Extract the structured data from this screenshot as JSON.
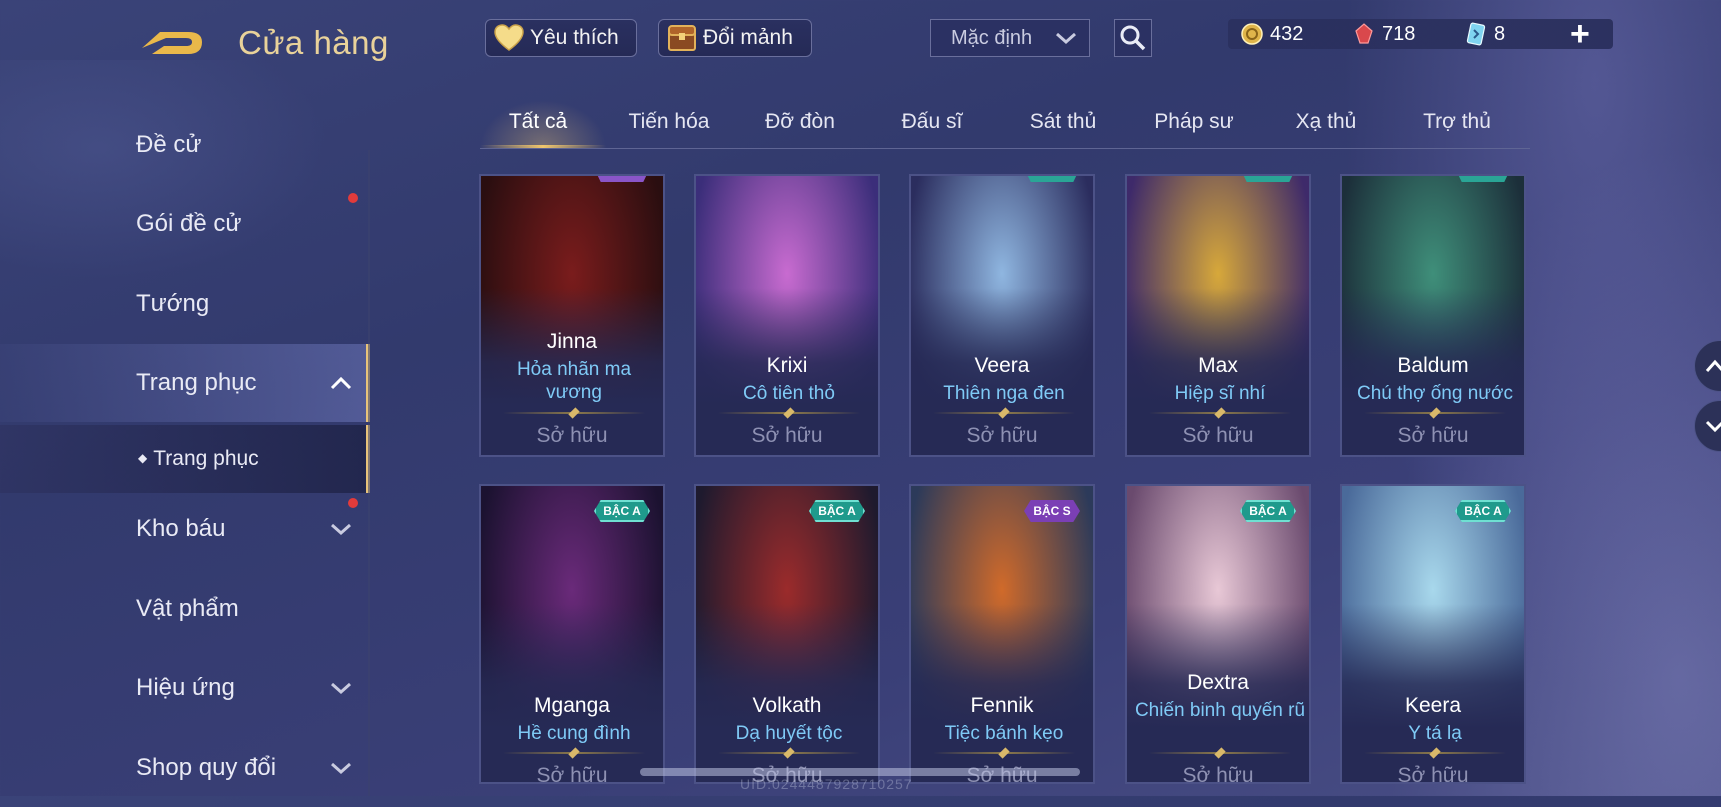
{
  "header": {
    "title": "Cửa hàng",
    "favorite_label": "Yêu thích",
    "exchange_label": "Đổi mảnh",
    "sort_value": "Mặc định",
    "currency": {
      "gold": "432",
      "gems": "718",
      "vouchers": "8"
    }
  },
  "sidebar": {
    "items": [
      {
        "label": "Đề cử"
      },
      {
        "label": "Gói đề cử"
      },
      {
        "label": "Tướng"
      },
      {
        "label": "Trang phục"
      },
      {
        "label": "Trang phục"
      },
      {
        "label": "Kho báu"
      },
      {
        "label": "Vật phẩm"
      },
      {
        "label": "Hiệu ứng"
      },
      {
        "label": "Shop quy đổi"
      }
    ]
  },
  "tabs": [
    "Tất cả",
    "Tiến hóa",
    "Đỡ đòn",
    "Đấu sĩ",
    "Sát thủ",
    "Pháp sư",
    "Xạ thủ",
    "Trợ thủ"
  ],
  "cards": [
    {
      "hero": "Jinna",
      "skin": "Hỏa nhãn ma vương",
      "status": "Sở hữu",
      "colors": [
        "#7a1c1c",
        "#2a0e10"
      ]
    },
    {
      "hero": "Krixi",
      "skin": "Cô tiên thỏ",
      "status": "Sở hữu",
      "colors": [
        "#c86bd0",
        "#3b2e7a"
      ]
    },
    {
      "hero": "Veera",
      "skin": "Thiên nga đen",
      "status": "Sở hữu",
      "colors": [
        "#8fb6e0",
        "#2b2d5e"
      ]
    },
    {
      "hero": "Max",
      "skin": "Hiệp sĩ nhí",
      "status": "Sở hữu",
      "colors": [
        "#d7a83a",
        "#3e2a6a"
      ]
    },
    {
      "hero": "Baldum",
      "skin": "Chú thợ ống nước",
      "status": "Sở hữu",
      "colors": [
        "#3f8f7a",
        "#1c2f3a"
      ]
    },
    {
      "hero": "Mganga",
      "skin": "Hề cung đình",
      "status": "Sở hữu",
      "badge": "BẬC A",
      "colors": [
        "#6a2a7a",
        "#1b1230"
      ]
    },
    {
      "hero": "Volkath",
      "skin": "Dạ huyết tộc",
      "status": "Sở hữu",
      "badge": "BẬC A",
      "colors": [
        "#9b2b2b",
        "#1e1a2e"
      ]
    },
    {
      "hero": "Fennik",
      "skin": "Tiệc bánh kẹo",
      "status": "Sở hữu",
      "badge": "BẬC S",
      "colors": [
        "#d06a2a",
        "#2c3a5a"
      ]
    },
    {
      "hero": "Dextra",
      "skin": "Chiến binh quyến rũ",
      "status": "Sở hữu",
      "badge": "BẬC A",
      "colors": [
        "#e8c8d6",
        "#6a4a6e"
      ]
    },
    {
      "hero": "Keera",
      "skin": "Y tá lạ",
      "status": "Sở hữu",
      "badge": "BẬC A",
      "colors": [
        "#a8d8ec",
        "#4a6a9a"
      ]
    }
  ],
  "uid_text": "UID:0244487928710257"
}
